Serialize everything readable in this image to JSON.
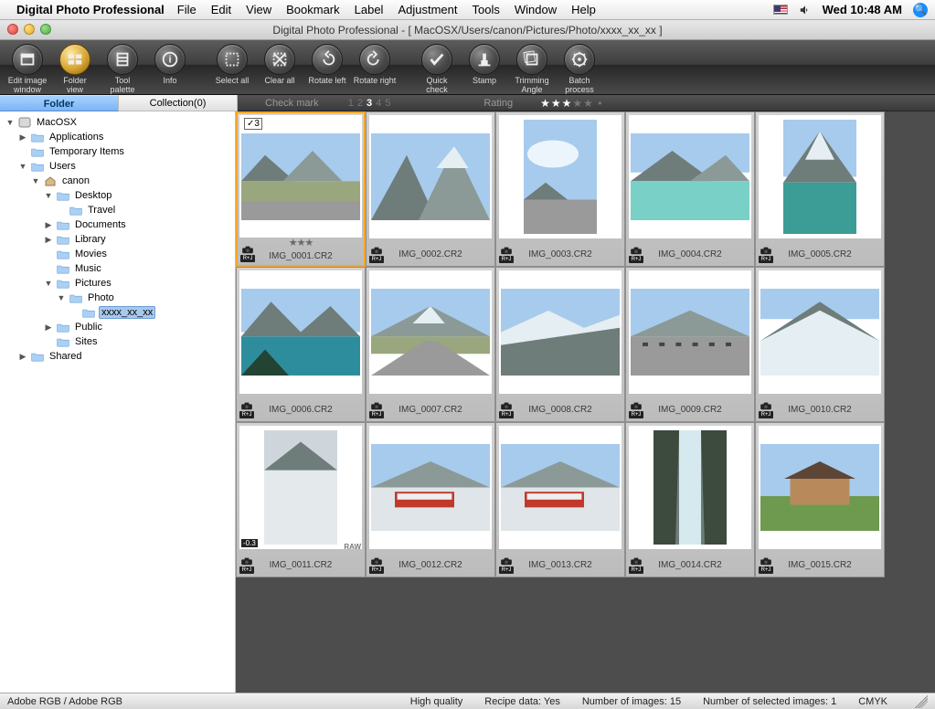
{
  "menubar": {
    "app_name": "Digital Photo Professional",
    "items": [
      "File",
      "Edit",
      "View",
      "Bookmark",
      "Label",
      "Adjustment",
      "Tools",
      "Window",
      "Help"
    ],
    "clock": "Wed 10:48 AM"
  },
  "window": {
    "title": "Digital Photo Professional - [ MacOSX/Users/canon/Pictures/Photo/xxxx_xx_xx ]"
  },
  "toolbar": {
    "items": [
      {
        "id": "edit-image-window",
        "label": "Edit image\nwindow"
      },
      {
        "id": "folder-view",
        "label": "Folder\nview",
        "selected": true
      },
      {
        "id": "tool-palette",
        "label": "Tool\npalette"
      },
      {
        "id": "info",
        "label": "Info"
      },
      {
        "id": "select-all",
        "label": "Select all"
      },
      {
        "id": "clear-all",
        "label": "Clear all"
      },
      {
        "id": "rotate-left",
        "label": "Rotate left"
      },
      {
        "id": "rotate-right",
        "label": "Rotate right"
      },
      {
        "id": "quick-check",
        "label": "Quick\ncheck"
      },
      {
        "id": "stamp",
        "label": "Stamp"
      },
      {
        "id": "trimming-angle",
        "label": "Trimming\nAngle"
      },
      {
        "id": "batch-process",
        "label": "Batch\nprocess"
      }
    ]
  },
  "primary_tabs": {
    "folder": "Folder",
    "collection": "Collection(0)"
  },
  "markup_bar": {
    "check_label": "Check mark",
    "check_values": [
      "1",
      "2",
      "3",
      "4",
      "5"
    ],
    "check_active": "3",
    "rating_label": "Rating",
    "rating_stars": 3
  },
  "tree": [
    {
      "depth": 0,
      "twisty": "down",
      "icon": "disk",
      "label": "MacOSX"
    },
    {
      "depth": 1,
      "twisty": "right",
      "icon": "folder",
      "label": "Applications"
    },
    {
      "depth": 1,
      "twisty": "",
      "icon": "folder",
      "label": "Temporary Items"
    },
    {
      "depth": 1,
      "twisty": "down",
      "icon": "folder",
      "label": "Users"
    },
    {
      "depth": 2,
      "twisty": "down",
      "icon": "home",
      "label": "canon"
    },
    {
      "depth": 3,
      "twisty": "down",
      "icon": "folder",
      "label": "Desktop"
    },
    {
      "depth": 4,
      "twisty": "",
      "icon": "folder",
      "label": "Travel"
    },
    {
      "depth": 3,
      "twisty": "right",
      "icon": "folder",
      "label": "Documents"
    },
    {
      "depth": 3,
      "twisty": "right",
      "icon": "folder",
      "label": "Library"
    },
    {
      "depth": 3,
      "twisty": "",
      "icon": "folder",
      "label": "Movies"
    },
    {
      "depth": 3,
      "twisty": "",
      "icon": "folder",
      "label": "Music"
    },
    {
      "depth": 3,
      "twisty": "down",
      "icon": "folder",
      "label": "Pictures"
    },
    {
      "depth": 4,
      "twisty": "down",
      "icon": "folder",
      "label": "Photo"
    },
    {
      "depth": 5,
      "twisty": "",
      "icon": "folder",
      "label": "xxxx_xx_xx",
      "selected": true
    },
    {
      "depth": 3,
      "twisty": "right",
      "icon": "folder",
      "label": "Public"
    },
    {
      "depth": 3,
      "twisty": "",
      "icon": "folder",
      "label": "Sites"
    },
    {
      "depth": 1,
      "twisty": "right",
      "icon": "folder",
      "label": "Shared"
    }
  ],
  "thumbnails": [
    {
      "file": "IMG_0001.CR2",
      "selected": true,
      "stars": 3,
      "check": "3",
      "variant": "valley-wide"
    },
    {
      "file": "IMG_0002.CR2",
      "variant": "peaks"
    },
    {
      "file": "IMG_0003.CR2",
      "variant": "sky-road",
      "portrait": true
    },
    {
      "file": "IMG_0004.CR2",
      "variant": "turquoise-lake"
    },
    {
      "file": "IMG_0005.CR2",
      "variant": "glacier-lake",
      "portrait": true
    },
    {
      "file": "IMG_0006.CR2",
      "variant": "moraine-lake"
    },
    {
      "file": "IMG_0007.CR2",
      "variant": "highway-mtn"
    },
    {
      "file": "IMG_0008.CR2",
      "variant": "snow-ridge"
    },
    {
      "file": "IMG_0009.CR2",
      "variant": "viewpoint"
    },
    {
      "file": "IMG_0010.CR2",
      "variant": "glacier-face"
    },
    {
      "file": "IMG_0011.CR2",
      "variant": "icefield",
      "portrait": true,
      "ev": "-0.3",
      "raw": "RAW"
    },
    {
      "file": "IMG_0012.CR2",
      "variant": "snowcoach"
    },
    {
      "file": "IMG_0013.CR2",
      "variant": "snowcoach"
    },
    {
      "file": "IMG_0014.CR2",
      "variant": "waterfall",
      "portrait": true
    },
    {
      "file": "IMG_0015.CR2",
      "variant": "lodge"
    }
  ],
  "statusbar": {
    "colorspace": "Adobe RGB / Adobe RGB",
    "quality": "High quality",
    "recipe": "Recipe data: Yes",
    "count": "Number of images: 15",
    "selected": "Number of selected images: 1",
    "mode": "CMYK"
  }
}
